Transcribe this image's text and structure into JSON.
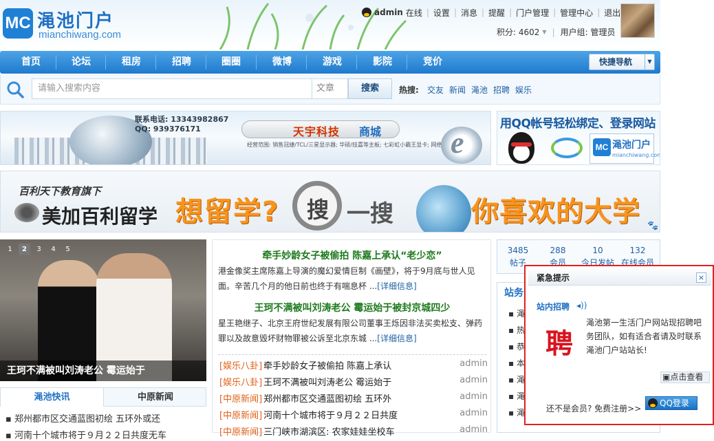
{
  "logo": {
    "cn": "渑池门户",
    "en": "mianchiwang.com",
    "badge": "MC"
  },
  "user": {
    "name": "admin",
    "status": "在线",
    "links": [
      "设置",
      "消息",
      "提醒",
      "门户管理",
      "管理中心",
      "退出"
    ],
    "points_label": "积分: 4602",
    "group_label": "用户组: 管理员"
  },
  "nav": {
    "items": [
      "首页",
      "论坛",
      "租房",
      "招聘",
      "圈圈",
      "微博",
      "游戏",
      "影院",
      "竞价"
    ],
    "quick_nav": "快捷导航"
  },
  "search": {
    "placeholder": "请输入搜索内容",
    "type": "文章",
    "button": "搜索",
    "hot_label": "热搜:",
    "hot": [
      "交友",
      "新闻",
      "渑池",
      "招聘",
      "娱乐"
    ]
  },
  "banner1": {
    "phone": "联系电话: 13343982867",
    "qq": "QQ: 939376171",
    "title_a": "天宇科技",
    "title_b": "商城",
    "small": "经营范围: 销售冠捷/TCL/三星显示器; 华硕/技嘉等主板; 七彩虹小霸王显卡; 网络设备: 监控安装;"
  },
  "banner2": {
    "title": "用QQ帐号轻松绑定、登录网站",
    "logo_cn": "渑池门户",
    "logo_en": "mianchiwang.com",
    "logo_badge": "MC"
  },
  "banner3": {
    "brand_top": "百利天下教育旗下",
    "brand": "美加百利留学",
    "text_a": "想留学?",
    "mag": "搜",
    "text_b": "一搜",
    "text_c": "你喜欢的大学"
  },
  "slider": {
    "pages": [
      "1",
      "2",
      "3",
      "4",
      "5"
    ],
    "active": 1,
    "caption": "王珂不满被叫刘涛老公 霉运始于"
  },
  "tabs": {
    "t1": "渑池快讯",
    "t2": "中原新闻"
  },
  "quick_news": [
    "郑州都市区交通蓝图初绘 五环外或还",
    "河南十个城市将于９月２２日共度无车"
  ],
  "headlines": [
    {
      "title": "牵手妙龄女子被偷拍 陈嘉上承认“老少恋”",
      "desc": "港金像奖主席陈嘉上导演的魔幻爱情巨制《画壁》，将于9月底与世人见面。辛苦几个月的他日前也终于有喘息杯 ...",
      "more": "[详细信息]"
    },
    {
      "title": "王珂不满被叫刘涛老公 霉运始于被封京城四少",
      "desc": "星王艳继子、北京王府世纪发展有限公司董事王烁因非法买卖松支、弹药罪以及故意毁坏财物罪被公诉至北京东城 ...",
      "more": "[详细信息]"
    }
  ],
  "news_list": [
    {
      "cat": "[娱乐八卦]",
      "title": "牵手妙龄女子被偷拍 陈嘉上承认",
      "author": "admin"
    },
    {
      "cat": "[娱乐八卦]",
      "title": "王珂不满被叫刘涛老公 霉运始于",
      "author": "admin"
    },
    {
      "cat": "[中原新闻]",
      "title": "郑州都市区交通蓝图初绘 五环外",
      "author": "admin"
    },
    {
      "cat": "[中原新闻]",
      "title": "河南十个城市将于９月２２日共度",
      "author": "admin"
    },
    {
      "cat": "[中原新闻]",
      "title": "三门峡市湖滨区: 农家娃娃坐校车",
      "author": "admin"
    }
  ],
  "stats": [
    {
      "n": "3485",
      "l": "帖子"
    },
    {
      "n": "288",
      "l": "会员"
    },
    {
      "n": "10",
      "l": "今日发帖"
    },
    {
      "n": "132",
      "l": "在线会员"
    }
  ],
  "service": {
    "title": "站务公",
    "items": [
      "渑池",
      "热烈祝",
      "恭喜",
      "本站",
      "渑池",
      "渑池",
      "渑池"
    ]
  },
  "popup": {
    "title": "紧急提示",
    "close": "×",
    "subtitle": "站内招聘",
    "seal": "聘",
    "body": "渑池第一生活门户网站现招聘吧务团队，如有适合者请及时联系渑池门户站站长!",
    "view": "点击查看",
    "footer": "还不是会员? 免费注册>>",
    "qq_login": "QQ登录"
  }
}
